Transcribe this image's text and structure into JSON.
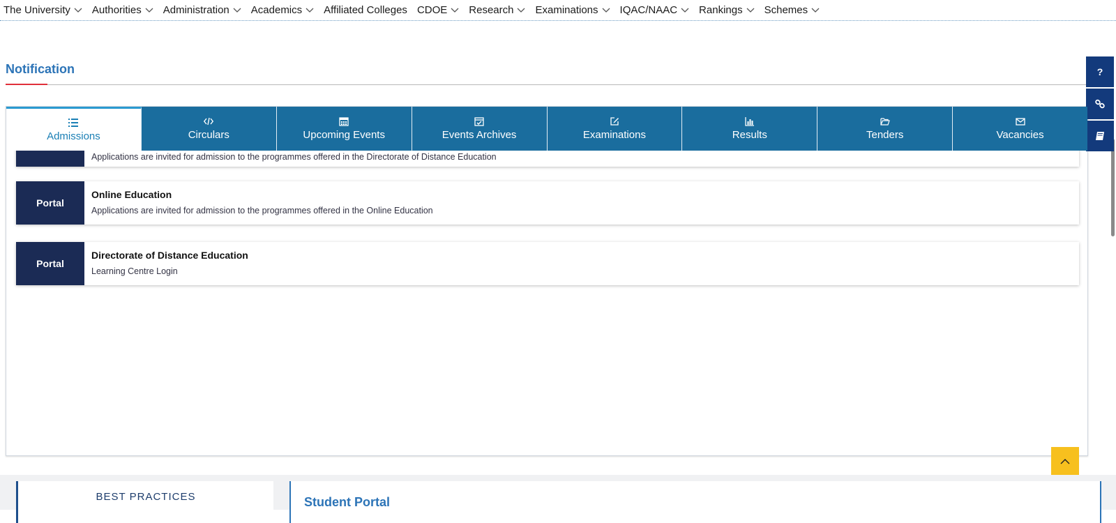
{
  "nav": {
    "items": [
      {
        "label": "The University",
        "dropdown": true
      },
      {
        "label": "Authorities",
        "dropdown": true
      },
      {
        "label": "Administration",
        "dropdown": true
      },
      {
        "label": "Academics",
        "dropdown": true
      },
      {
        "label": "Affiliated Colleges",
        "dropdown": false
      },
      {
        "label": "CDOE",
        "dropdown": true
      },
      {
        "label": "Research",
        "dropdown": true
      },
      {
        "label": "Examinations",
        "dropdown": true
      },
      {
        "label": "IQAC/NAAC",
        "dropdown": true
      },
      {
        "label": "Rankings",
        "dropdown": true
      },
      {
        "label": "Schemes",
        "dropdown": true
      }
    ]
  },
  "notification": {
    "title": "Notification",
    "tabs": [
      {
        "label": "Admissions",
        "icon": "list-icon",
        "active": true
      },
      {
        "label": "Circulars",
        "icon": "code-icon",
        "active": false
      },
      {
        "label": "Upcoming Events",
        "icon": "calendar-icon",
        "active": false
      },
      {
        "label": "Events Archives",
        "icon": "calendar-check-icon",
        "active": false
      },
      {
        "label": "Examinations",
        "icon": "edit-icon",
        "active": false
      },
      {
        "label": "Results",
        "icon": "bar-chart-icon",
        "active": false
      },
      {
        "label": "Tenders",
        "icon": "folder-open-icon",
        "active": false
      },
      {
        "label": "Vacancies",
        "icon": "envelope-icon",
        "active": false
      }
    ],
    "items": [
      {
        "badge": "",
        "title": "",
        "description": "Applications are invited for admission to the programmes offered in the Directorate of Distance Education"
      },
      {
        "badge": "Portal",
        "title": "Online Education",
        "description": "Applications are invited for admission to the programmes offered in the Online Education"
      },
      {
        "badge": "Portal",
        "title": "Directorate of Distance Education",
        "description": "Learning Centre Login"
      }
    ]
  },
  "float_tools": [
    {
      "glyph": "?",
      "icon": "help-icon"
    },
    {
      "glyph": "",
      "icon": "link-icon"
    },
    {
      "glyph": "",
      "icon": "book-icon"
    }
  ],
  "bottom": {
    "best_practices": "BEST PRACTICES",
    "student_portal": "Student Portal"
  },
  "colors": {
    "tab_bg": "#1a6d9e",
    "badge_bg": "#1b2b55",
    "accent_blue": "#2c74b7",
    "float_bg": "#133a7c",
    "to_top_bg": "#f7c01e"
  }
}
